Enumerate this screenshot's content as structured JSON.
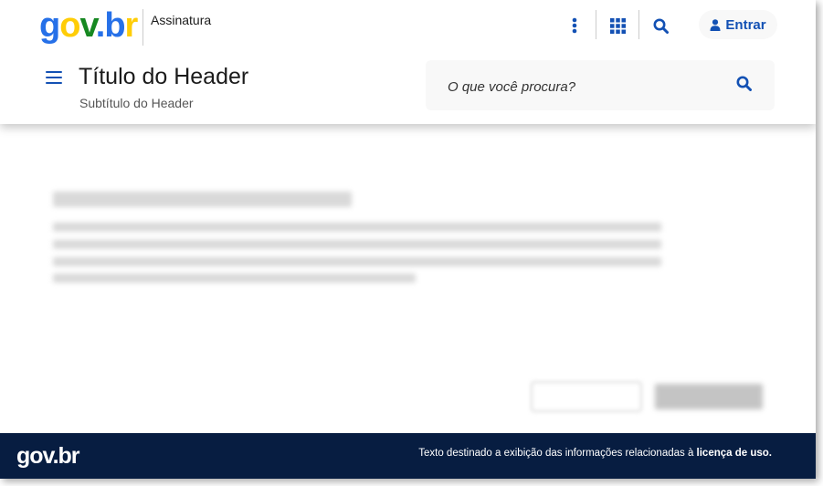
{
  "header": {
    "logo": {
      "g": "g",
      "o": "o",
      "v": "v",
      "dot": ".",
      "b": "b",
      "r": "r"
    },
    "product_label": "Assinatura",
    "login_label": "Entrar",
    "title": "Título do Header",
    "subtitle": "Subtítulo do Header",
    "search_placeholder": "O que você procura?"
  },
  "footer": {
    "logo_text": "gov.br",
    "license_text_prefix": "Texto destinado a exibição das informações relacionadas à ",
    "license_link": "licença de uso."
  },
  "colors": {
    "primary": "#1351b4",
    "footer_bg": "#071d41"
  }
}
